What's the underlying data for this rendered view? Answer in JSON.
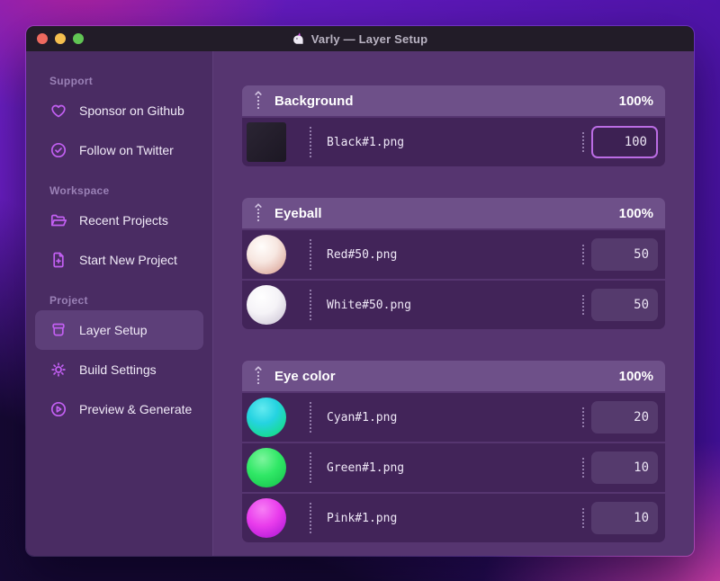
{
  "window": {
    "title": "Varly — Layer Setup",
    "app_icon": "unicorn-icon",
    "traffic_lights": {
      "close": "#ee6a5f",
      "minimize": "#f5bf4f",
      "zoom": "#61c554"
    }
  },
  "sidebar": {
    "sections": [
      {
        "label": "Support",
        "items": [
          {
            "icon": "heart-icon",
            "label": "Sponsor on Github"
          },
          {
            "icon": "verified-check-icon",
            "label": "Follow on Twitter"
          }
        ]
      },
      {
        "label": "Workspace",
        "items": [
          {
            "icon": "open-folder-icon",
            "label": "Recent Projects"
          },
          {
            "icon": "file-plus-icon",
            "label": "Start New Project"
          }
        ]
      },
      {
        "label": "Project",
        "items": [
          {
            "icon": "archive-box-icon",
            "label": "Layer Setup",
            "selected": true
          },
          {
            "icon": "gear-icon",
            "label": "Build Settings"
          },
          {
            "icon": "play-circle-icon",
            "label": "Preview & Generate"
          }
        ]
      }
    ]
  },
  "main": {
    "groups": [
      {
        "name": "Background",
        "percent": "100%",
        "layers": [
          {
            "filename": "Black#1.png",
            "value": "100",
            "thumb": "black-swatch",
            "thumb_color": "#221c29",
            "focused": true
          }
        ]
      },
      {
        "name": "Eyeball",
        "percent": "100%",
        "layers": [
          {
            "filename": "Red#50.png",
            "value": "50",
            "thumb": "pearl-red-sphere",
            "thumb_color": "#e8c4bc"
          },
          {
            "filename": "White#50.png",
            "value": "50",
            "thumb": "white-sphere",
            "thumb_color": "#f2f0f4"
          }
        ]
      },
      {
        "name": "Eye color",
        "percent": "100%",
        "layers": [
          {
            "filename": "Cyan#1.png",
            "value": "20",
            "thumb": "cyan-sphere",
            "thumb_color": "#1fd0c4"
          },
          {
            "filename": "Green#1.png",
            "value": "10",
            "thumb": "green-sphere",
            "thumb_color": "#22dd5e"
          },
          {
            "filename": "Pink#1.png",
            "value": "10",
            "thumb": "pink-sphere",
            "thumb_color": "#d92df0"
          }
        ]
      }
    ]
  },
  "colors": {
    "accent_icon": "#c25ff2",
    "focused_input_border": "#bb6ce4",
    "titlebar": "#221c28",
    "sidebar_bg": "#4a2c63",
    "main_bg": "#563570",
    "group_header_bg": "#6e5089",
    "row_bg": "#422459"
  }
}
